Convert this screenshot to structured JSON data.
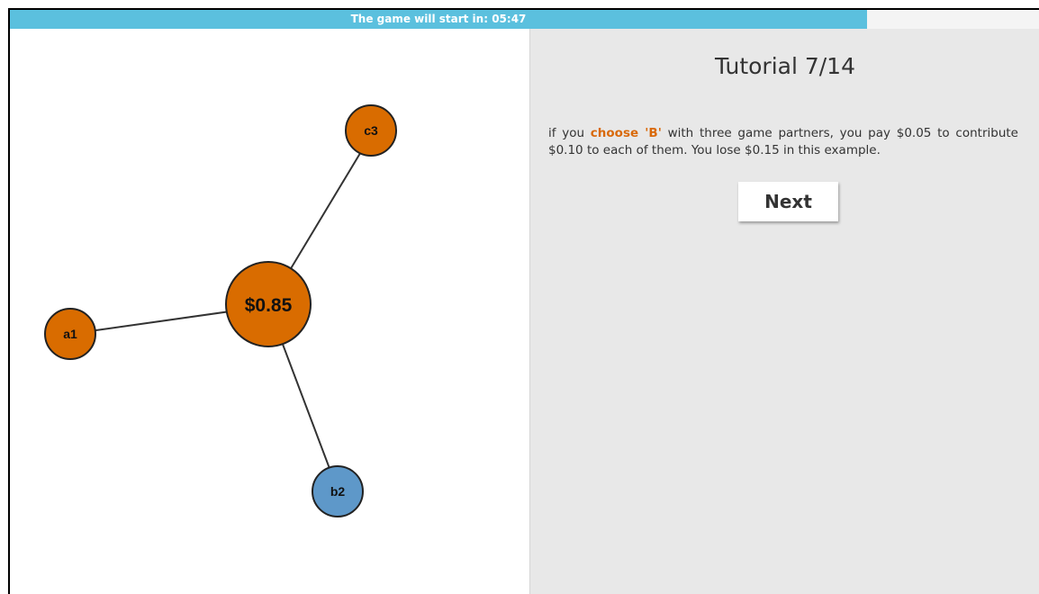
{
  "timer": {
    "label": "The game will start in: 05:47",
    "progress_fraction": 0.833,
    "fill_color": "#5bc0de"
  },
  "graph": {
    "center_node": {
      "label": "$0.85",
      "color": "#d96c00"
    },
    "nodes": [
      {
        "id": "c3",
        "label": "c3",
        "color": "#d96c00"
      },
      {
        "id": "a1",
        "label": "a1",
        "color": "#d96c00"
      },
      {
        "id": "b2",
        "label": "b2",
        "color": "#5e98c9"
      }
    ]
  },
  "panel": {
    "title": "Tutorial 7/14",
    "text_before": "if you ",
    "highlight": "choose 'B'",
    "text_after": " with three game partners, you pay $0.05 to contribute $0.10 to each of them. You lose $0.15 in this example.",
    "highlight_color": "#d9690a",
    "next_label": "Next"
  }
}
